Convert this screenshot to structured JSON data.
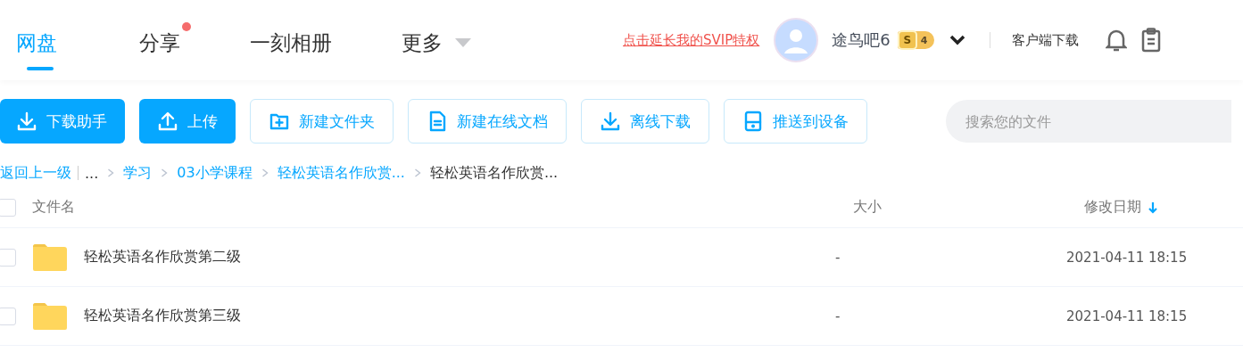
{
  "nav": {
    "tabs": [
      {
        "label": "网盘",
        "selected": true,
        "dot": false,
        "caret": false
      },
      {
        "label": "分享",
        "selected": false,
        "dot": true,
        "caret": false
      },
      {
        "label": "一刻相册",
        "selected": false,
        "dot": false,
        "caret": false
      },
      {
        "label": "更多",
        "selected": false,
        "dot": false,
        "caret": true
      }
    ]
  },
  "user": {
    "promo_link": "点击延长我的SVIP特权",
    "name": "途鸟吧6",
    "vip_badge": {
      "letter": "S",
      "number": "4"
    },
    "client_download": "客户端下载"
  },
  "toolbar": {
    "buttons": [
      {
        "label": "下载助手",
        "kind": "primary"
      },
      {
        "label": "上传",
        "kind": "primary"
      },
      {
        "label": "新建文件夹",
        "kind": "outline"
      },
      {
        "label": "新建在线文档",
        "kind": "outline"
      },
      {
        "label": "离线下载",
        "kind": "outline"
      },
      {
        "label": "推送到设备",
        "kind": "outline"
      }
    ],
    "search": {
      "placeholder": "搜索您的文件"
    }
  },
  "breadcrumb": {
    "back": "返回上一级",
    "items": [
      {
        "label": "...",
        "kind": "ellipsis"
      },
      {
        "label": "学习",
        "kind": "link"
      },
      {
        "label": "03小学课程",
        "kind": "link"
      },
      {
        "label": "轻松英语名作欣赏...",
        "kind": "link"
      },
      {
        "label": "轻松英语名作欣赏...",
        "kind": "current"
      }
    ]
  },
  "table": {
    "select_all": {
      "checked": false
    },
    "columns": [
      "文件名",
      "大小",
      "修改日期"
    ],
    "rows": [
      {
        "checked": false,
        "name": "轻松英语名作欣赏第二级",
        "size": "-",
        "modified": "2021-04-11 18:15"
      },
      {
        "checked": false,
        "name": "轻松英语名作欣赏第三级",
        "size": "-",
        "modified": "2021-04-11 18:15"
      }
    ]
  }
}
